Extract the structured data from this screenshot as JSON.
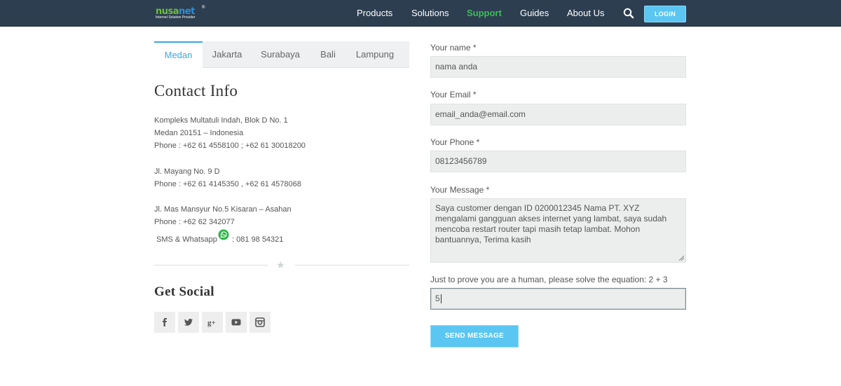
{
  "brand": {
    "logo_a": "nusa",
    "logo_b": "net",
    "tagline": "Internet Solution Provider",
    "reg": "®"
  },
  "nav": {
    "items": [
      {
        "label": "Products"
      },
      {
        "label": "Solutions"
      },
      {
        "label": "Support",
        "active": true
      },
      {
        "label": "Guides"
      },
      {
        "label": "About Us"
      }
    ],
    "search_icon": "search-icon",
    "login_label": "LOGIN"
  },
  "tabs": [
    {
      "label": "Medan",
      "active": true
    },
    {
      "label": "Jakarta"
    },
    {
      "label": "Surabaya"
    },
    {
      "label": "Bali"
    },
    {
      "label": "Lampung"
    }
  ],
  "contact": {
    "title": "Contact Info",
    "block1": [
      "Kompleks Multatuli Indah, Blok D No. 1",
      "Medan 20151 – Indonesia",
      "Phone : +62 61 4558100 ; +62 61 30018200"
    ],
    "block2": [
      "Jl. Mayang No. 9 D",
      "Phone : +62 61 4145350 , +62 61 4578068"
    ],
    "block3": [
      "Jl. Mas Mansyur No.5 Kisaran – Asahan",
      "Phone : +62 62 342077"
    ],
    "sms_label": "SMS & Whatsapp",
    "sms_number": ": 081 98 54321"
  },
  "social": {
    "title": "Get Social",
    "icons": [
      "facebook-icon",
      "twitter-icon",
      "google-plus-icon",
      "youtube-icon",
      "instagram-icon"
    ]
  },
  "form": {
    "name_label": "Your name *",
    "name_value": "nama anda",
    "email_label": "Your Email *",
    "email_value": "email_anda@email.com",
    "phone_label": "Your Phone *",
    "phone_value": "08123456789",
    "message_label": "Your Message *",
    "message_value": "Saya customer dengan ID 0200012345 Nama PT. XYZ mengalami gangguan akses internet yang lambat, saya sudah mencoba restart router tapi masih tetap lambat. Mohon bantuannya, Terima kasih",
    "captcha_label": "Just to prove you are a human, please solve the equation: 2 + 3",
    "captcha_value": "5",
    "send_label": "SEND MESSAGE"
  },
  "colors": {
    "header_bg": "#2d3e50",
    "accent": "#5bc6f2",
    "active_nav": "#3fba5b",
    "tab_active": "#3aa8e0"
  }
}
